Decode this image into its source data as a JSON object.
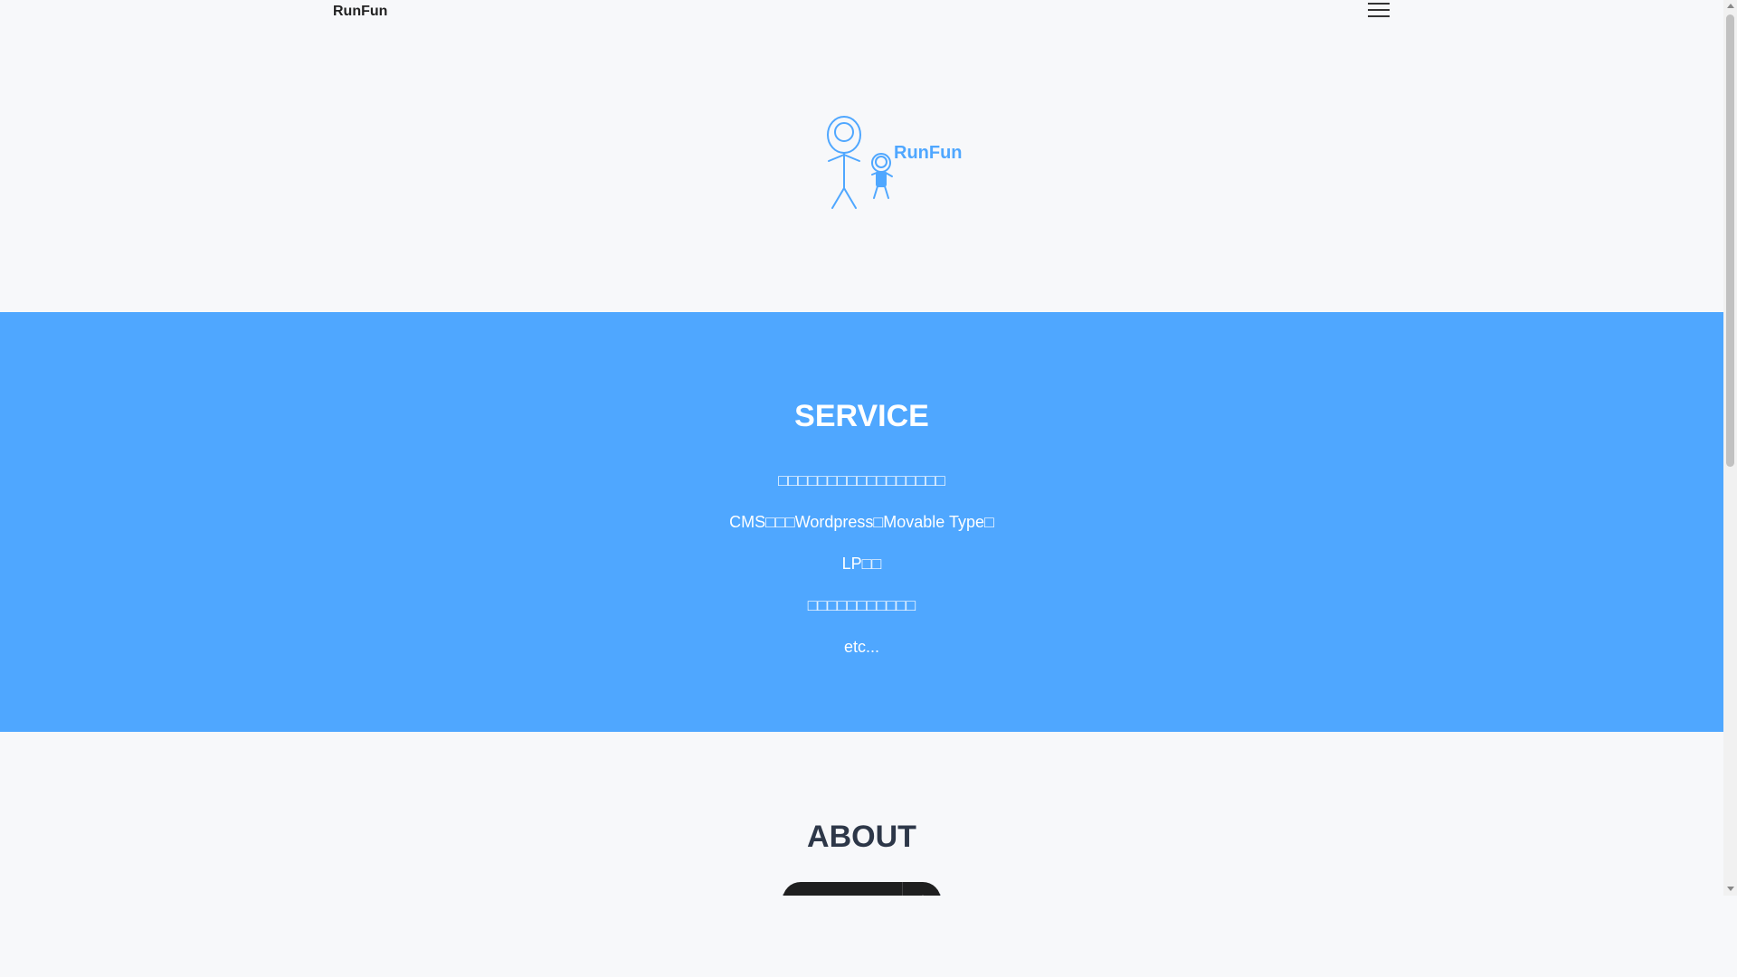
{
  "header": {
    "brand": "RunFun",
    "menu_icon": "hamburger-menu-icon"
  },
  "hero": {
    "logo_icon": "stick-figures-parent-child-icon",
    "logo_text": "RunFun"
  },
  "service": {
    "title": "SERVICE",
    "items": [
      "□□□□□□□□□□□□□□□□□",
      "CMS□□□Wordpress□Movable Type□",
      "LP□□",
      "□□□□□□□□□□□",
      "etc..."
    ]
  },
  "about": {
    "title": "ABOUT",
    "text": "□□□□□□□□□□□□□□□□□□"
  },
  "floating_toolbar": {
    "icons": [
      "pointer-icon",
      "page-icon",
      "menu-lines-icon",
      "settings-icon"
    ]
  },
  "colors": {
    "background": "#f7f8fa",
    "accent": "#4fa7ff",
    "heading_dark": "#2d3748",
    "text_on_accent": "#ffffff"
  }
}
